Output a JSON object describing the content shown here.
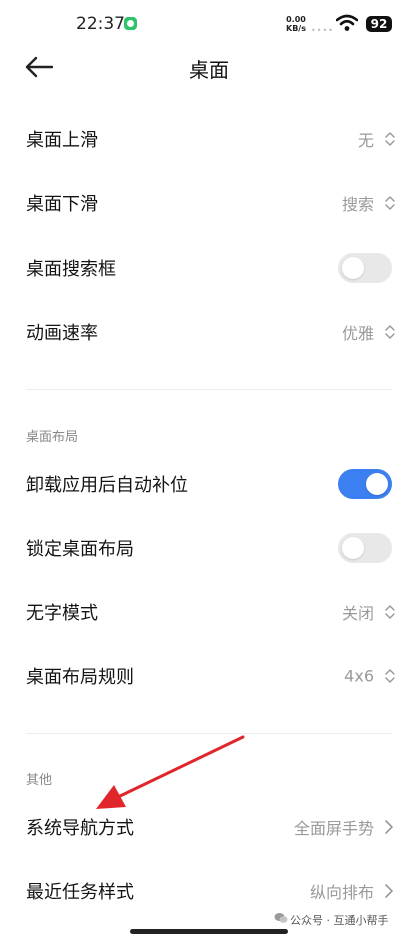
{
  "status_bar": {
    "time": "22:37",
    "net_speed_value": "0.00",
    "net_speed_unit": "KB/s",
    "battery": "92"
  },
  "header": {
    "title": "桌面"
  },
  "sections": {
    "desktop": {
      "rows": [
        {
          "label": "桌面上滑",
          "value": "无"
        },
        {
          "label": "桌面下滑",
          "value": "搜索"
        },
        {
          "label": "桌面搜索框",
          "toggle": false
        },
        {
          "label": "动画速率",
          "value": "优雅"
        }
      ]
    },
    "layout": {
      "title": "桌面布局",
      "rows": [
        {
          "label": "卸载应用后自动补位",
          "toggle": true
        },
        {
          "label": "锁定桌面布局",
          "toggle": false
        },
        {
          "label": "无字模式",
          "value": "关闭"
        },
        {
          "label": "桌面布局规则",
          "value": "4x6"
        }
      ]
    },
    "other": {
      "title": "其他",
      "rows": [
        {
          "label": "系统导航方式",
          "value": "全面屏手势"
        },
        {
          "label": "最近任务样式",
          "value": "纵向排布"
        }
      ]
    }
  },
  "watermark": "公众号 · 互通小帮手",
  "colors": {
    "accent": "#3c7ff0",
    "toggle_off": "#e8e8e8",
    "annotation_arrow": "#e0262b"
  },
  "icons": [
    "back-arrow-icon",
    "updown-icon",
    "chevron-right-icon",
    "wifi-icon",
    "wechat-icon"
  ]
}
